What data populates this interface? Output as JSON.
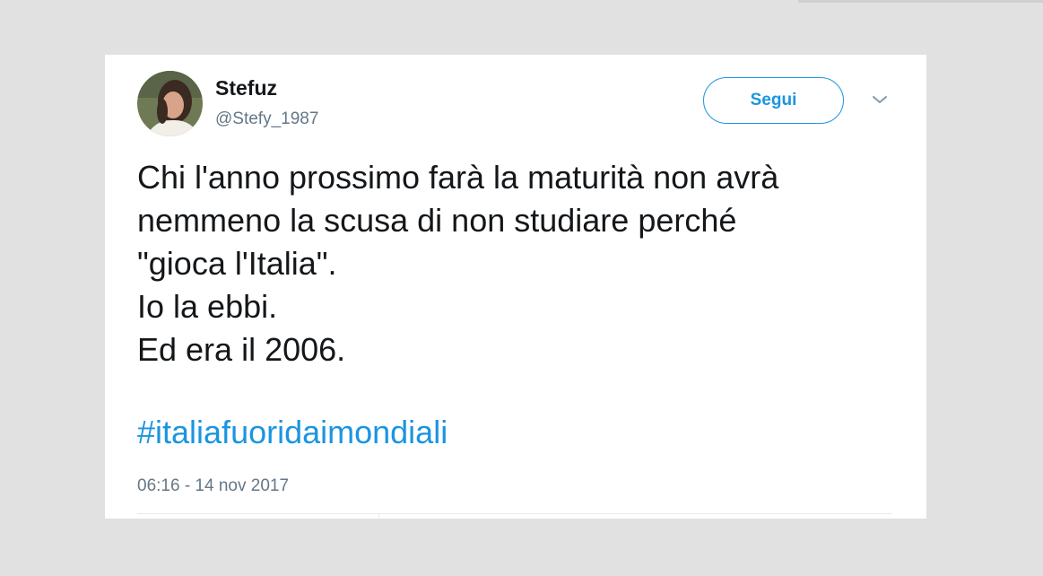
{
  "tweet": {
    "display_name": "Stefuz",
    "handle": "@Stefy_1987",
    "follow_label": "Segui",
    "text_lines": [
      "Chi l'anno prossimo farà la maturità non avrà",
      "nemmeno la scusa di non studiare perché",
      "\"gioca l'Italia\".",
      "Io la ebbi.",
      "Ed era il 2006."
    ],
    "hashtag": "#italiafuoridaimondiali",
    "timestamp": "06:16 - 14 nov 2017"
  },
  "icons": {
    "avatar": "avatar-photo",
    "menu": "chevron-down-icon"
  },
  "colors": {
    "accent": "#1b95e0",
    "text": "#14171a",
    "secondary": "#657786",
    "background": "#e1e1e1",
    "card": "#ffffff"
  }
}
